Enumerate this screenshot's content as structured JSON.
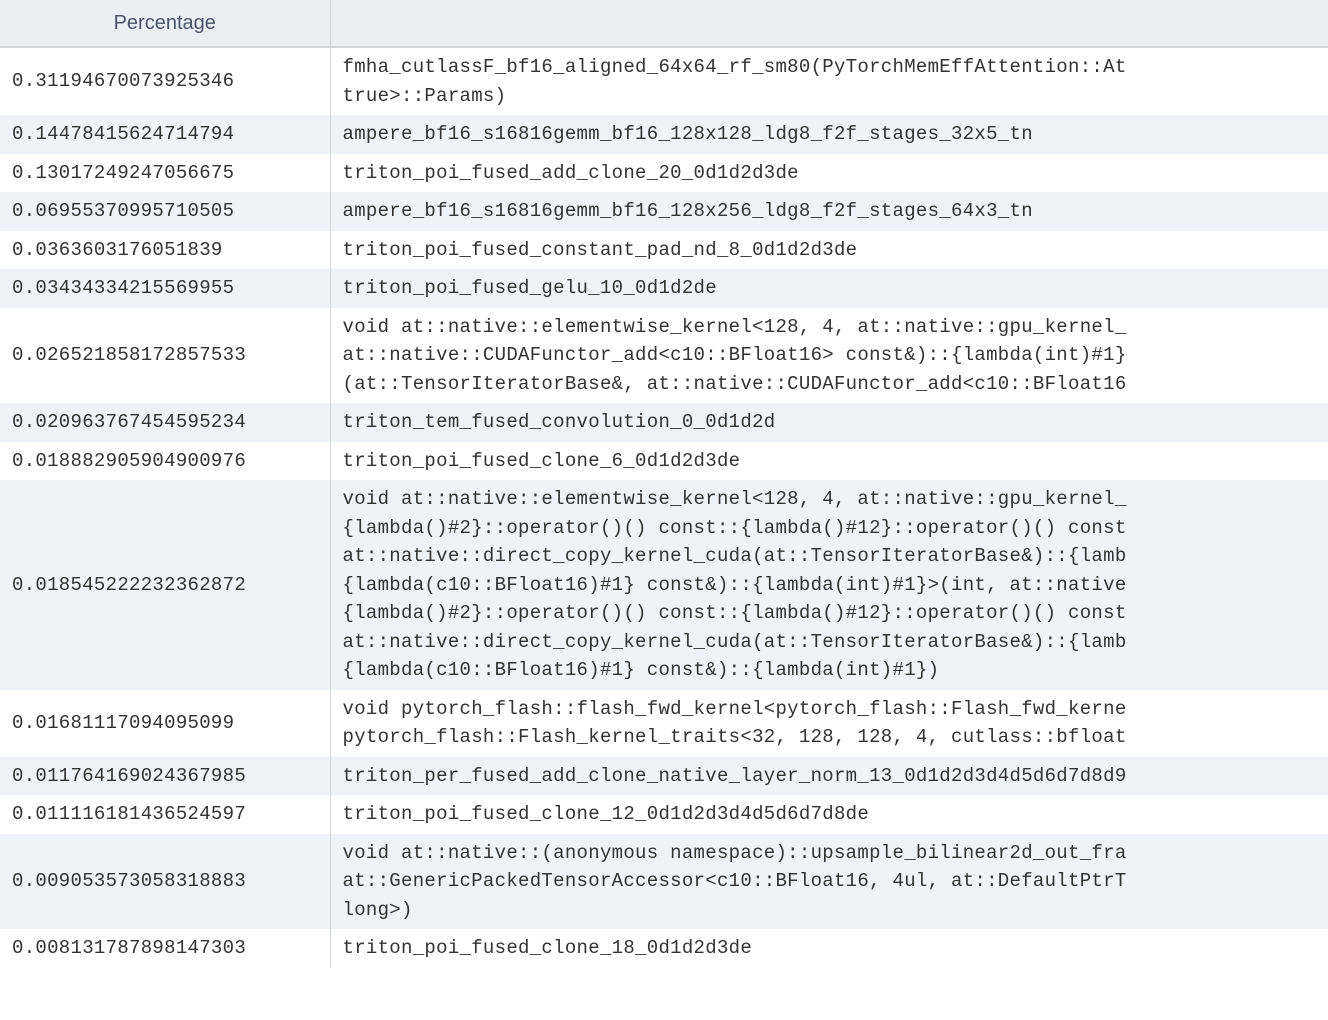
{
  "table": {
    "headers": {
      "percentage": "Percentage",
      "kernel": ""
    },
    "rows": [
      {
        "percentage": "0.31194670073925346",
        "kernel": "fmha_cutlassF_bf16_aligned_64x64_rf_sm80(PyTorchMemEffAttention::At\ntrue>::Params)"
      },
      {
        "percentage": "0.14478415624714794",
        "kernel": "ampere_bf16_s16816gemm_bf16_128x128_ldg8_f2f_stages_32x5_tn"
      },
      {
        "percentage": "0.13017249247056675",
        "kernel": "triton_poi_fused_add_clone_20_0d1d2d3de"
      },
      {
        "percentage": "0.06955370995710505",
        "kernel": "ampere_bf16_s16816gemm_bf16_128x256_ldg8_f2f_stages_64x3_tn"
      },
      {
        "percentage": "0.0363603176051839",
        "kernel": "triton_poi_fused_constant_pad_nd_8_0d1d2d3de"
      },
      {
        "percentage": "0.03434334215569955",
        "kernel": "triton_poi_fused_gelu_10_0d1d2de"
      },
      {
        "percentage": "0.026521858172857533",
        "kernel": "void at::native::elementwise_kernel<128, 4, at::native::gpu_kernel_\nat::native::CUDAFunctor_add<c10::BFloat16> const&)::{lambda(int)#1}\n(at::TensorIteratorBase&, at::native::CUDAFunctor_add<c10::BFloat16"
      },
      {
        "percentage": "0.020963767454595234",
        "kernel": "triton_tem_fused_convolution_0_0d1d2d"
      },
      {
        "percentage": "0.018882905904900976",
        "kernel": "triton_poi_fused_clone_6_0d1d2d3de"
      },
      {
        "percentage": "0.018545222232362872",
        "kernel": "void at::native::elementwise_kernel<128, 4, at::native::gpu_kernel_\n{lambda()#2}::operator()() const::{lambda()#12}::operator()() const\nat::native::direct_copy_kernel_cuda(at::TensorIteratorBase&)::{lamb\n{lambda(c10::BFloat16)#1} const&)::{lambda(int)#1}>(int, at::native\n{lambda()#2}::operator()() const::{lambda()#12}::operator()() const\nat::native::direct_copy_kernel_cuda(at::TensorIteratorBase&)::{lamb\n{lambda(c10::BFloat16)#1} const&)::{lambda(int)#1})"
      },
      {
        "percentage": "0.01681117094095099",
        "kernel": "void pytorch_flash::flash_fwd_kernel<pytorch_flash::Flash_fwd_kerne\npytorch_flash::Flash_kernel_traits<32, 128, 128, 4, cutlass::bfloat"
      },
      {
        "percentage": "0.011764169024367985",
        "kernel": "triton_per_fused_add_clone_native_layer_norm_13_0d1d2d3d4d5d6d7d8d9"
      },
      {
        "percentage": "0.011116181436524597",
        "kernel": "triton_poi_fused_clone_12_0d1d2d3d4d5d6d7d8de"
      },
      {
        "percentage": "0.009053573058318883",
        "kernel": "void at::native::(anonymous namespace)::upsample_bilinear2d_out_fra\nat::GenericPackedTensorAccessor<c10::BFloat16, 4ul, at::DefaultPtrT\nlong>)"
      },
      {
        "percentage": "0.008131787898147303",
        "kernel": "triton_poi_fused_clone_18_0d1d2d3de"
      }
    ]
  }
}
